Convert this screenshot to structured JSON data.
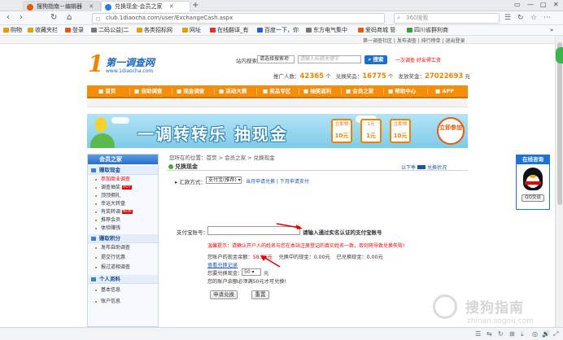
{
  "browser": {
    "tabs": [
      {
        "title": "搜狗指南－编辑器",
        "icon_color": "#e8560c"
      },
      {
        "title": "兑换现金-会员之家",
        "icon_color": "#2a7de1"
      }
    ],
    "new_tab": "+",
    "window_controls": [
      "▭",
      "—",
      "□",
      "✕"
    ],
    "url": "club.1diaocha.com/user/ExchangeCash.aspx",
    "search_placeholder": "360搜索",
    "nav": {
      "back": "‹",
      "forward": "›",
      "reload": "↻",
      "home": "⌂"
    },
    "bookmarks": [
      {
        "label": "购物",
        "color": "#e2a100"
      },
      {
        "label": "收藏夹栏",
        "color": "#e2a100"
      },
      {
        "label": "登录",
        "color": "#e85a0c"
      },
      {
        "label": "二码公益|二",
        "color": "#777"
      },
      {
        "label": "各类招标网",
        "color": "#e2a100"
      },
      {
        "label": "网址",
        "color": "#e2a100"
      },
      {
        "label": "在线翻译_有",
        "color": "#d33"
      },
      {
        "label": "百度一下，你",
        "color": "#2a5bd7"
      },
      {
        "label": "东方电气集中",
        "color": "#777"
      },
      {
        "label": "爱码商城 管",
        "color": "#e85a0c"
      },
      {
        "label": "四川省群利商",
        "color": "#3a9b3a"
      }
    ],
    "bookmarks_more": "»"
  },
  "site": {
    "top_links": "第一调查社区 | 发布调查 | 排行榜单 | 退出登录",
    "logo": {
      "mark": "1",
      "name": "第一调查网",
      "url": "www.1diaocha.com"
    },
    "search": {
      "label": "站内搜索",
      "select_value": "请选择搜索项",
      "input_placeholder": "请输入标题关键字",
      "button": "搜索",
      "hot": "一次调查  好友得工资"
    },
    "stats": {
      "label1": "推广人数：",
      "value1": "42365",
      "label2": "兑换奖品：",
      "value2": "16775",
      "label3": "发放奖金：",
      "value3": "27022693",
      "unit_person": "个",
      "unit_yuan": "元"
    },
    "nav": [
      "首页",
      "自助调查",
      "现金调查",
      "活动大赛",
      "奖品专区",
      "抽奖返利",
      "会员之家",
      "帮助中心",
      "APP"
    ],
    "banner": {
      "title": "一调转转乐 抽现金",
      "cards": [
        {
          "top": "立即领",
          "num": "10元"
        },
        {
          "top": "1元",
          "num": "1元"
        },
        {
          "top": "立即领",
          "num": "10元"
        }
      ],
      "join": "立即参加"
    }
  },
  "sidebar": {
    "head": "会员之家",
    "sections": [
      {
        "title": "赚取现金",
        "items": [
          {
            "label": "参加商业调查",
            "highlight": true,
            "badge": ""
          },
          {
            "label": "调查抽奖",
            "highlight": false,
            "badge": "HOT"
          },
          {
            "label": "顶顶拥礼",
            "highlight": false,
            "badge": ""
          },
          {
            "label": "幸运大转盘",
            "highlight": false,
            "badge": ""
          },
          {
            "label": "有奖转调",
            "highlight": false,
            "badge": "NEW"
          },
          {
            "label": "推荐会员",
            "highlight": false,
            "badge": ""
          },
          {
            "label": "体验赚钱",
            "highlight": false,
            "badge": ""
          }
        ]
      },
      {
        "title": "赚取积分",
        "items": [
          {
            "label": "发布自助调查",
            "highlight": false,
            "badge": ""
          },
          {
            "label": "提交行优惠",
            "highlight": false,
            "badge": ""
          },
          {
            "label": "报过道相调查",
            "highlight": false,
            "badge": ""
          }
        ]
      },
      {
        "title": "个人资料",
        "items": [
          {
            "label": "基本信息",
            "highlight": false,
            "badge": ""
          },
          {
            "label": "账户信息",
            "highlight": false,
            "badge": ""
          }
        ]
      }
    ]
  },
  "content": {
    "breadcrumb": "您所在的位置：首页 > 会员之家 > 兑换现金",
    "title": "兑换现金",
    "right_links": {
      "left": "以下季",
      "right": "兑换状况"
    },
    "method_label": "汇款方式：",
    "method_value": "支付宝(推荐)",
    "method_links": "当月申请兑换 | 下月申请支付",
    "account_label": "支付宝账号：",
    "account_value": "",
    "account_hint": "请输入通过实名认证的支付宝账号",
    "warning": "温馨提示：请确认开户人的姓名与您在本站注册登记的真实姓名一致，否则将导致兑换失败!",
    "balance_label": "您账户的现金余额：",
    "balance_value": "58.36元",
    "pending_label": "兑换中的现金：",
    "pending_value": "0.00元",
    "done_label": "已兑换现金：",
    "done_value": "0.00元",
    "history_link": "查看兑换记录",
    "amount_label": "您要兑换现金：",
    "amount_value": "50",
    "amount_unit": "元",
    "min_note": "您的账户余额必须满50元才可兑换!",
    "submit": "申请兑换",
    "reset": "重置"
  },
  "qq_panel": {
    "title": "在线咨询",
    "button": "QQ交谈"
  },
  "watermark": {
    "text": "搜狗指南",
    "url": "zhinan.sogou.com"
  },
  "statusbar": {
    "icons": [
      "☰",
      "⇆",
      "↻",
      "⊞",
      "⤓",
      "◎",
      "🔊",
      "⤢"
    ]
  }
}
